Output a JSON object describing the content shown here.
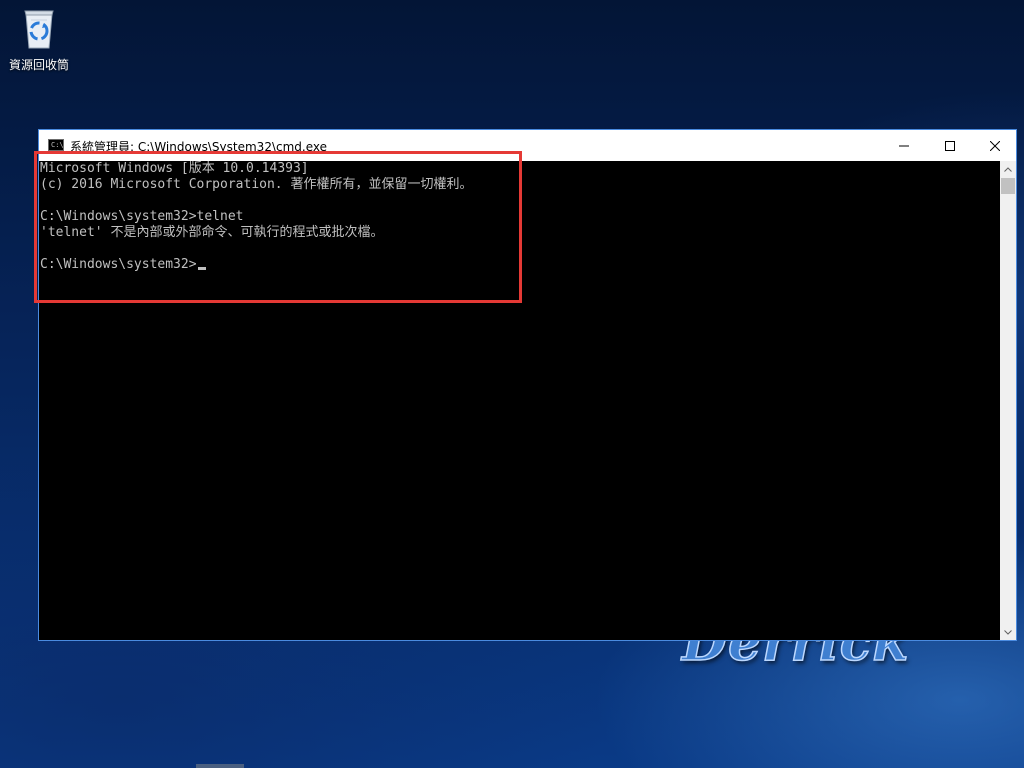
{
  "desktop": {
    "icons": [
      {
        "label": "資源回收筒",
        "icon": "recycle-bin-icon"
      }
    ],
    "watermark_text": "Derrick"
  },
  "window": {
    "title": "系統管理員: C:\\Windows\\System32\\cmd.exe",
    "app_icon": "cmd-icon",
    "buttons": {
      "minimize_icon": "minimize-icon",
      "maximize_icon": "maximize-icon",
      "close_icon": "close-icon"
    }
  },
  "console": {
    "lines": [
      "Microsoft Windows [版本 10.0.14393]",
      "(c) 2016 Microsoft Corporation. 著作權所有，並保留一切權利。",
      "",
      "C:\\Windows\\system32>telnet",
      "'telnet' 不是內部或外部命令、可執行的程式或批次檔。",
      "",
      "C:\\Windows\\system32>"
    ],
    "text_color": "#c0c0c0",
    "background_color": "#000000"
  },
  "annotation": {
    "highlight_color": "#e53935"
  }
}
